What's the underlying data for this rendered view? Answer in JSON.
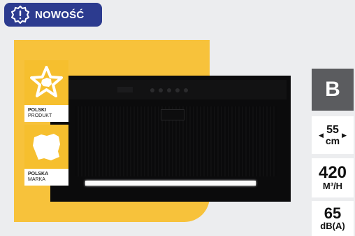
{
  "new_badge": {
    "label": "NOWOŚĆ",
    "icon": "badge-exclamation-icon",
    "color": "#2c3b8f"
  },
  "product_image": {
    "icon": "cooker-hood-image"
  },
  "origin_badges": [
    {
      "title": "POLSKI",
      "subtitle": "PRODUKT",
      "icon": "star-poland-icon"
    },
    {
      "title": "POLSKA",
      "subtitle": "MARKA",
      "icon": "poland-map-icon"
    }
  ],
  "specs": {
    "energy_class": "B",
    "width": {
      "value": "55",
      "unit": "cm"
    },
    "airflow": {
      "value": "420",
      "unit": "M³/H"
    },
    "noise": {
      "value": "65",
      "unit": "dB(A)"
    }
  },
  "colors": {
    "accent_yellow": "#f7c23b",
    "energy_bg": "#5b5c5f"
  }
}
